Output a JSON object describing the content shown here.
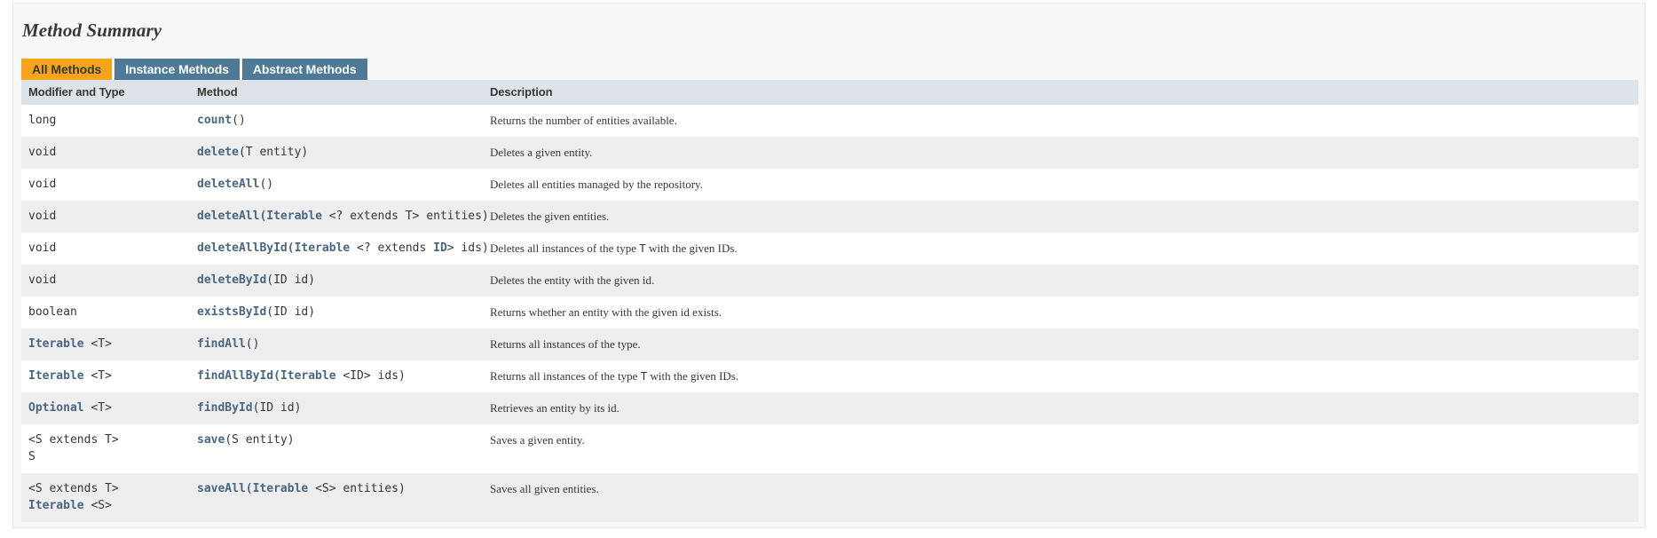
{
  "section": {
    "title": "Method Summary"
  },
  "tabs": [
    {
      "label": "All Methods",
      "state": "active"
    },
    {
      "label": "Instance Methods",
      "state": "inactive"
    },
    {
      "label": "Abstract Methods",
      "state": "inactive"
    }
  ],
  "table": {
    "columns": [
      "Modifier and Type",
      "Method",
      "Description"
    ],
    "rows": [
      {
        "modifier_lines": [
          [
            {
              "t": "long",
              "k": "plain"
            }
          ]
        ],
        "method": [
          {
            "t": "count",
            "k": "lnk"
          },
          {
            "t": "()",
            "k": "plain"
          }
        ],
        "description": [
          {
            "t": "Returns the number of entities available.",
            "k": "text"
          }
        ]
      },
      {
        "modifier_lines": [
          [
            {
              "t": "void",
              "k": "plain"
            }
          ]
        ],
        "method": [
          {
            "t": "delete",
            "k": "lnk"
          },
          {
            "t": "(T entity)",
            "k": "plain"
          }
        ],
        "description": [
          {
            "t": "Deletes a given entity.",
            "k": "text"
          }
        ]
      },
      {
        "modifier_lines": [
          [
            {
              "t": "void",
              "k": "plain"
            }
          ]
        ],
        "method": [
          {
            "t": "deleteAll",
            "k": "lnk"
          },
          {
            "t": "()",
            "k": "plain"
          }
        ],
        "description": [
          {
            "t": "Deletes all entities managed by the repository.",
            "k": "text"
          }
        ]
      },
      {
        "modifier_lines": [
          [
            {
              "t": "void",
              "k": "plain"
            }
          ]
        ],
        "method": [
          {
            "t": "deleteAll(",
            "k": "lnk"
          },
          {
            "t": "Iterable",
            "k": "lnk"
          },
          {
            "t": " <? extends T> entities)",
            "k": "plain"
          }
        ],
        "description": [
          {
            "t": "Deletes the given entities.",
            "k": "text"
          }
        ]
      },
      {
        "modifier_lines": [
          [
            {
              "t": "void",
              "k": "plain"
            }
          ]
        ],
        "method": [
          {
            "t": "deleteAllById(",
            "k": "lnk"
          },
          {
            "t": "Iterable",
            "k": "lnk"
          },
          {
            "t": " <? extends ",
            "k": "plain"
          },
          {
            "t": "ID",
            "k": "lnk"
          },
          {
            "t": "> ids)",
            "k": "plain"
          }
        ],
        "description": [
          {
            "t": "Deletes all instances of the type ",
            "k": "text"
          },
          {
            "t": "T",
            "k": "tparam"
          },
          {
            "t": " with the given IDs.",
            "k": "text"
          }
        ]
      },
      {
        "modifier_lines": [
          [
            {
              "t": "void",
              "k": "plain"
            }
          ]
        ],
        "method": [
          {
            "t": "deleteById",
            "k": "lnk"
          },
          {
            "t": "(ID id)",
            "k": "plain"
          }
        ],
        "description": [
          {
            "t": "Deletes the entity with the given id.",
            "k": "text"
          }
        ]
      },
      {
        "modifier_lines": [
          [
            {
              "t": "boolean",
              "k": "plain"
            }
          ]
        ],
        "method": [
          {
            "t": "existsById",
            "k": "lnk"
          },
          {
            "t": "(ID id)",
            "k": "plain"
          }
        ],
        "description": [
          {
            "t": "Returns whether an entity with the given id exists.",
            "k": "text"
          }
        ]
      },
      {
        "modifier_lines": [
          [
            {
              "t": "Iterable",
              "k": "lnk"
            },
            {
              "t": " <T>",
              "k": "plain"
            }
          ]
        ],
        "method": [
          {
            "t": "findAll",
            "k": "lnk"
          },
          {
            "t": "()",
            "k": "plain"
          }
        ],
        "description": [
          {
            "t": "Returns all instances of the type.",
            "k": "text"
          }
        ]
      },
      {
        "modifier_lines": [
          [
            {
              "t": "Iterable",
              "k": "lnk"
            },
            {
              "t": " <T>",
              "k": "plain"
            }
          ]
        ],
        "method": [
          {
            "t": "findAllById(",
            "k": "lnk"
          },
          {
            "t": "Iterable",
            "k": "lnk"
          },
          {
            "t": " <ID> ids)",
            "k": "plain"
          }
        ],
        "description": [
          {
            "t": "Returns all instances of the type ",
            "k": "text"
          },
          {
            "t": "T",
            "k": "tparam"
          },
          {
            "t": " with the given IDs.",
            "k": "text"
          }
        ]
      },
      {
        "modifier_lines": [
          [
            {
              "t": "Optional",
              "k": "lnk"
            },
            {
              "t": " <T>",
              "k": "plain"
            }
          ]
        ],
        "method": [
          {
            "t": "findById",
            "k": "lnk"
          },
          {
            "t": "(ID id)",
            "k": "plain"
          }
        ],
        "description": [
          {
            "t": "Retrieves an entity by its id.",
            "k": "text"
          }
        ]
      },
      {
        "modifier_lines": [
          [
            {
              "t": "<S extends T>",
              "k": "plain"
            }
          ],
          [
            {
              "t": "S",
              "k": "plain"
            }
          ]
        ],
        "method": [
          {
            "t": "save",
            "k": "lnk"
          },
          {
            "t": "(S entity)",
            "k": "plain"
          }
        ],
        "description": [
          {
            "t": "Saves a given entity.",
            "k": "text"
          }
        ]
      },
      {
        "modifier_lines": [
          [
            {
              "t": "<S extends T>",
              "k": "plain"
            }
          ],
          [
            {
              "t": "Iterable",
              "k": "lnk"
            },
            {
              "t": " <S>",
              "k": "plain"
            }
          ]
        ],
        "method": [
          {
            "t": "saveAll(",
            "k": "lnk"
          },
          {
            "t": "Iterable",
            "k": "lnk"
          },
          {
            "t": " <S> entities)",
            "k": "plain"
          }
        ],
        "description": [
          {
            "t": "Saves all given entities.",
            "k": "text"
          }
        ]
      }
    ]
  },
  "colors": {
    "tab_active_bg": "#f7a41d",
    "tab_inactive_bg": "#4d7a97",
    "header_bg": "#dee3e9",
    "row_alt_bg": "#eeeeee",
    "link": "#4a6782",
    "text": "#353833"
  }
}
